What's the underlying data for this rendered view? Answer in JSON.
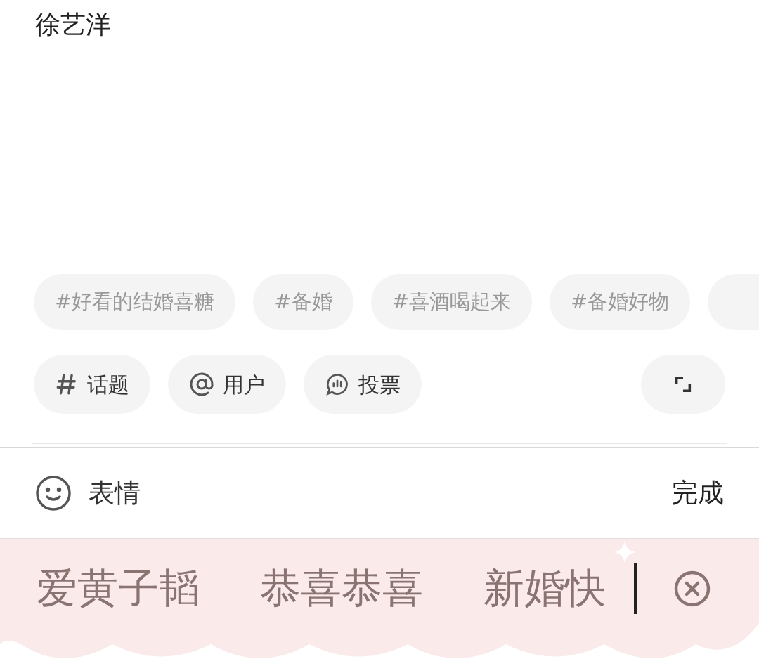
{
  "title": "徐艺洋",
  "tags": [
    {
      "label": "#好看的结婚喜糖"
    },
    {
      "label": "#备婚"
    },
    {
      "label": "#喜酒喝起来"
    },
    {
      "label": "#备婚好物"
    }
  ],
  "tools": [
    {
      "kind": "hash",
      "label": "话题"
    },
    {
      "kind": "at",
      "label": "用户"
    },
    {
      "kind": "poll",
      "label": "投票"
    }
  ],
  "emoji_bar": {
    "label": "表情",
    "done": "完成"
  },
  "candidates": [
    "爱黄子韬",
    "恭喜恭喜",
    "新婚快"
  ]
}
